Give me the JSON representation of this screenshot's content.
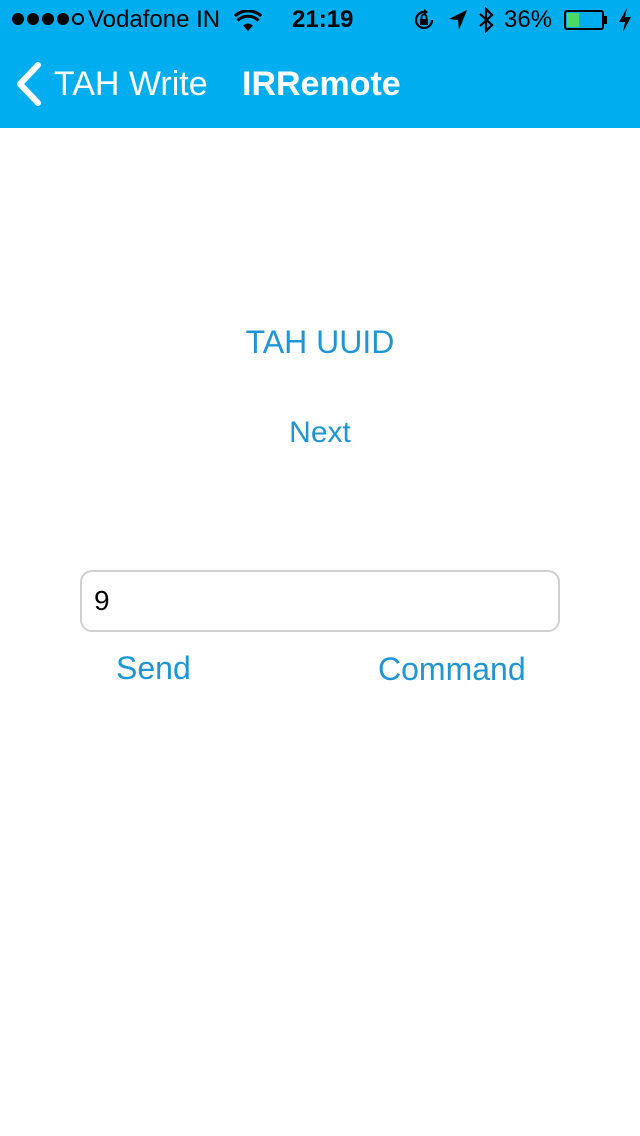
{
  "status_bar": {
    "signal_dots": [
      true,
      true,
      true,
      true,
      false
    ],
    "carrier": "Vodafone IN",
    "time": "21:19",
    "battery_percent_text": "36%",
    "battery_level": 0.36,
    "icons": [
      "wifi-icon",
      "rotation-lock-icon",
      "location-arrow-icon",
      "bluetooth-icon",
      "battery-icon",
      "charging-bolt-icon"
    ]
  },
  "nav": {
    "back_label": "TAH Write",
    "title": "IRRemote",
    "back_icon": "chevron-left-icon"
  },
  "content": {
    "uuid_button": "TAH UUID",
    "next_button": "Next",
    "command_input_value": "9",
    "send_button": "Send",
    "command_button": "Command"
  },
  "colors": {
    "nav_background": "#00ADEF",
    "link_blue": "#1E96D6",
    "battery_green": "#4CD964"
  }
}
